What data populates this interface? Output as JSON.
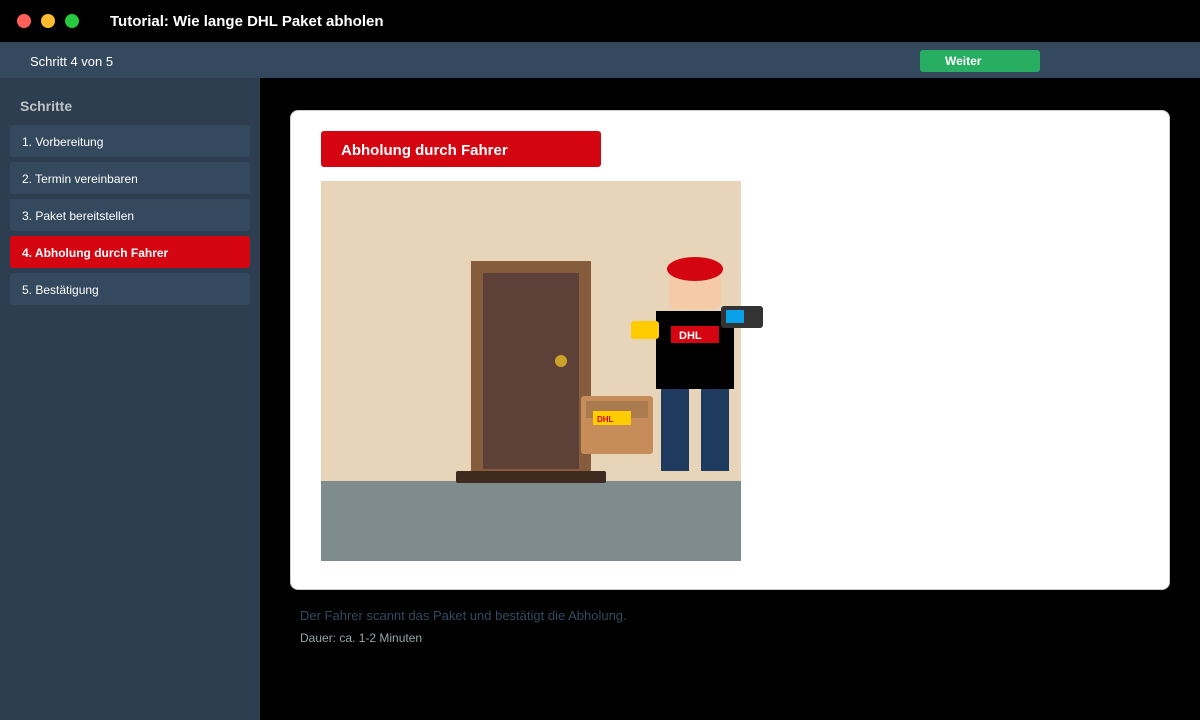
{
  "window": {
    "title": "Tutorial: Wie lange DHL Paket abholen"
  },
  "stepbar": {
    "counter": "Schritt 4 von 5",
    "next_label": "Weiter"
  },
  "sidebar": {
    "heading": "Schritte",
    "active_index": 3,
    "items": [
      {
        "label": "1. Vorbereitung"
      },
      {
        "label": "2. Termin vereinbaren"
      },
      {
        "label": "3. Paket bereitstellen"
      },
      {
        "label": "4. Abholung durch Fahrer"
      },
      {
        "label": "5. Bestätigung"
      }
    ]
  },
  "content": {
    "title": "Abholung durch Fahrer",
    "illustration": {
      "shirt_logo": "DHL",
      "package_label": "DHL"
    },
    "caption": "Der Fahrer scannt das Paket und bestätigt die Abholung.",
    "duration": "Dauer: ca. 1-2 Minuten"
  },
  "colors": {
    "dhl_red": "#d40511",
    "dhl_yellow": "#ffcc00",
    "accent_green": "#27ae60",
    "sidebar_bg": "#2c3e50",
    "sidebar_item_bg": "#34495e"
  }
}
